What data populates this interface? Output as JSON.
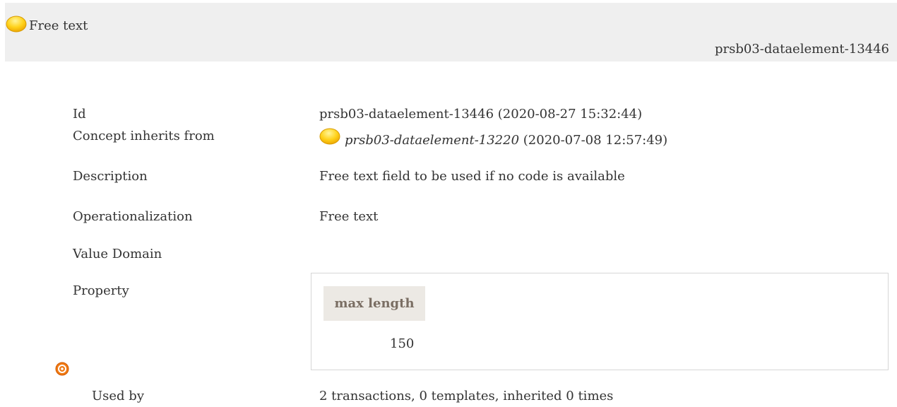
{
  "header": {
    "title": "Free text",
    "id": "prsb03-dataelement-13446"
  },
  "rows": {
    "id": {
      "label": "Id",
      "value": "prsb03-dataelement-13446 (2020-08-27 15:32:44)"
    },
    "inherits": {
      "label": "Concept inherits from",
      "link": "prsb03-dataelement-13220",
      "suffix": " (2020-07-08 12:57:49)"
    },
    "description": {
      "label": "Description",
      "value": "Free text field to be used if no code is available"
    },
    "operationalization": {
      "label": "Operationalization",
      "value": "Free text"
    },
    "value_domain": {
      "label": "Value Domain"
    },
    "property": {
      "label": "Property",
      "header": "max length",
      "value": "150"
    },
    "used_by": {
      "label": "Used by",
      "value": "2 transactions, 0 templates, inherited 0 times"
    }
  },
  "icons": {
    "concept": "item-status-icon",
    "used_by": "target-icon"
  },
  "colors": {
    "status_dot": "#f5b400",
    "used_by_icon": "#e8620a"
  }
}
